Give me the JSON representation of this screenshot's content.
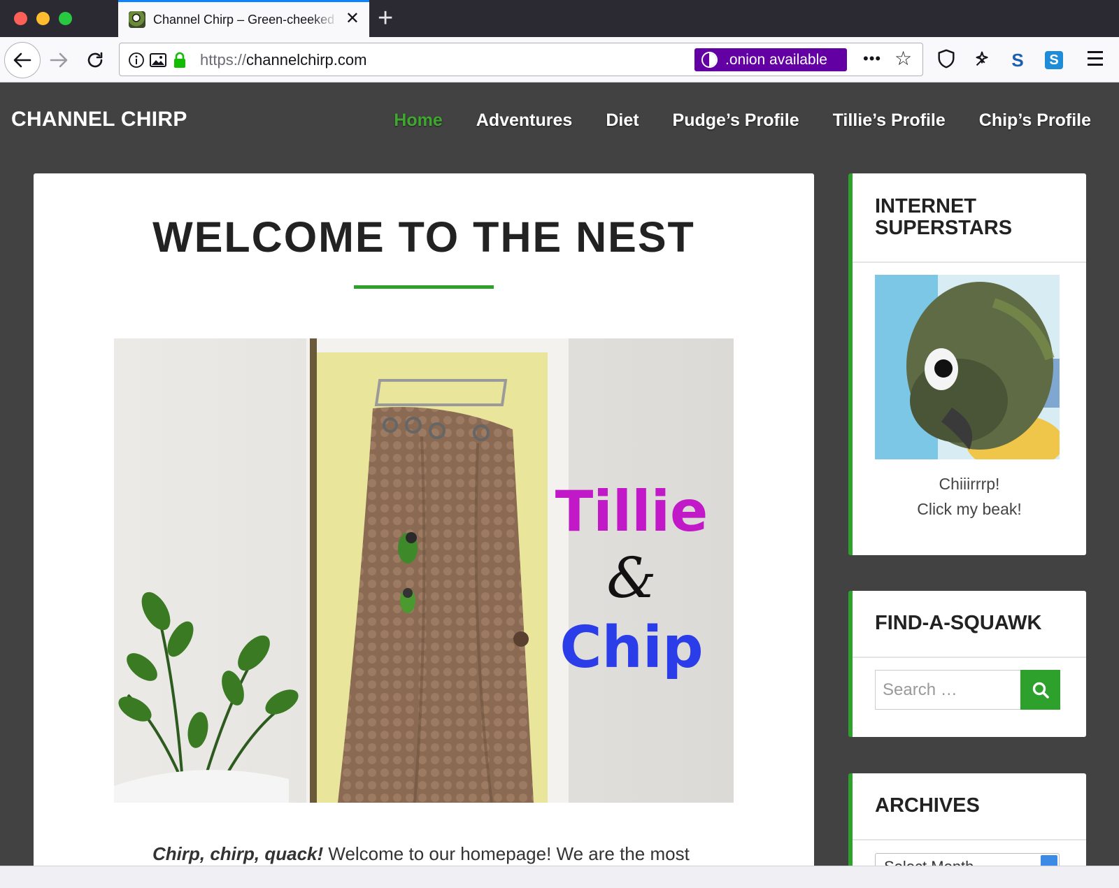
{
  "browser": {
    "tab_title": "Channel Chirp – Green-cheeked Conures",
    "tab_close_glyph": "✕",
    "new_tab_glyph": "+",
    "url_scheme": "https://",
    "url_host": "channelchirp.com",
    "onion_label": ".onion available",
    "more_glyph": "•••",
    "star_glyph": "☆",
    "ext_s_label": "S",
    "ext_s2_label": "S",
    "accent_color": "#0a84ff",
    "onion_color": "#6200a4"
  },
  "site": {
    "title": "CHANNEL CHIRP",
    "nav": [
      {
        "label": "Home",
        "active": true
      },
      {
        "label": "Adventures"
      },
      {
        "label": "Diet"
      },
      {
        "label": "Pudge’s Profile"
      },
      {
        "label": "Tillie’s Profile"
      },
      {
        "label": "Chip’s Profile"
      }
    ],
    "accent_color": "#2da12b",
    "header_bg": "#424242"
  },
  "post": {
    "title": "WELCOME TO THE NEST",
    "hero_caption_1": "Tillie",
    "hero_caption_2": "&",
    "hero_caption_3": "Chip",
    "intro_emphasis": "Chirp, chirp, quack!",
    "intro_text": " Welcome to our homepage! We are the most"
  },
  "sidebar": {
    "superstars": {
      "title": "INTERNET SUPERSTARS",
      "caption_line1": "Chiiirrrp!",
      "caption_line2": "Click my beak!"
    },
    "search": {
      "title": "FIND-A-SQUAWK",
      "placeholder": "Search …"
    },
    "archives": {
      "title": "ARCHIVES",
      "select_value": "Select Month"
    }
  }
}
